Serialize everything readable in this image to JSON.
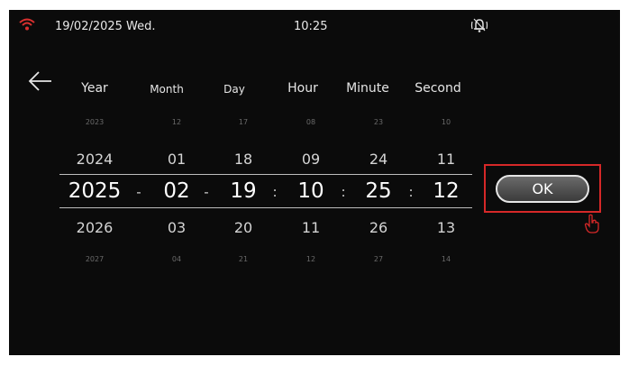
{
  "status_bar": {
    "wifi_icon": "wifi-icon",
    "date": "19/02/2025 Wed.",
    "time": "10:25",
    "alarm_icon": "bell-icon"
  },
  "back_icon": "arrow-left-icon",
  "picker": {
    "columns": [
      {
        "header": "Year",
        "far_top": "2023",
        "near_top": "2024",
        "current": "2025",
        "near_bottom": "2026",
        "far_bottom": "2027"
      },
      {
        "header": "Month",
        "far_top": "12",
        "near_top": "01",
        "current": "02",
        "near_bottom": "03",
        "far_bottom": "04"
      },
      {
        "header": "Day",
        "far_top": "17",
        "near_top": "18",
        "current": "19",
        "near_bottom": "20",
        "far_bottom": "21"
      },
      {
        "header": "Hour",
        "far_top": "08",
        "near_top": "09",
        "current": "10",
        "near_bottom": "11",
        "far_bottom": "12"
      },
      {
        "header": "Minute",
        "far_top": "23",
        "near_top": "24",
        "current": "25",
        "near_bottom": "26",
        "far_bottom": "27"
      },
      {
        "header": "Second",
        "far_top": "10",
        "near_top": "11",
        "current": "12",
        "near_bottom": "13",
        "far_bottom": "14"
      }
    ],
    "separators": [
      "-",
      "-",
      ":",
      ":",
      ":"
    ]
  },
  "ok_button": {
    "label": "OK"
  },
  "colors": {
    "highlight": "#d62828",
    "background": "#0b0b0b"
  }
}
